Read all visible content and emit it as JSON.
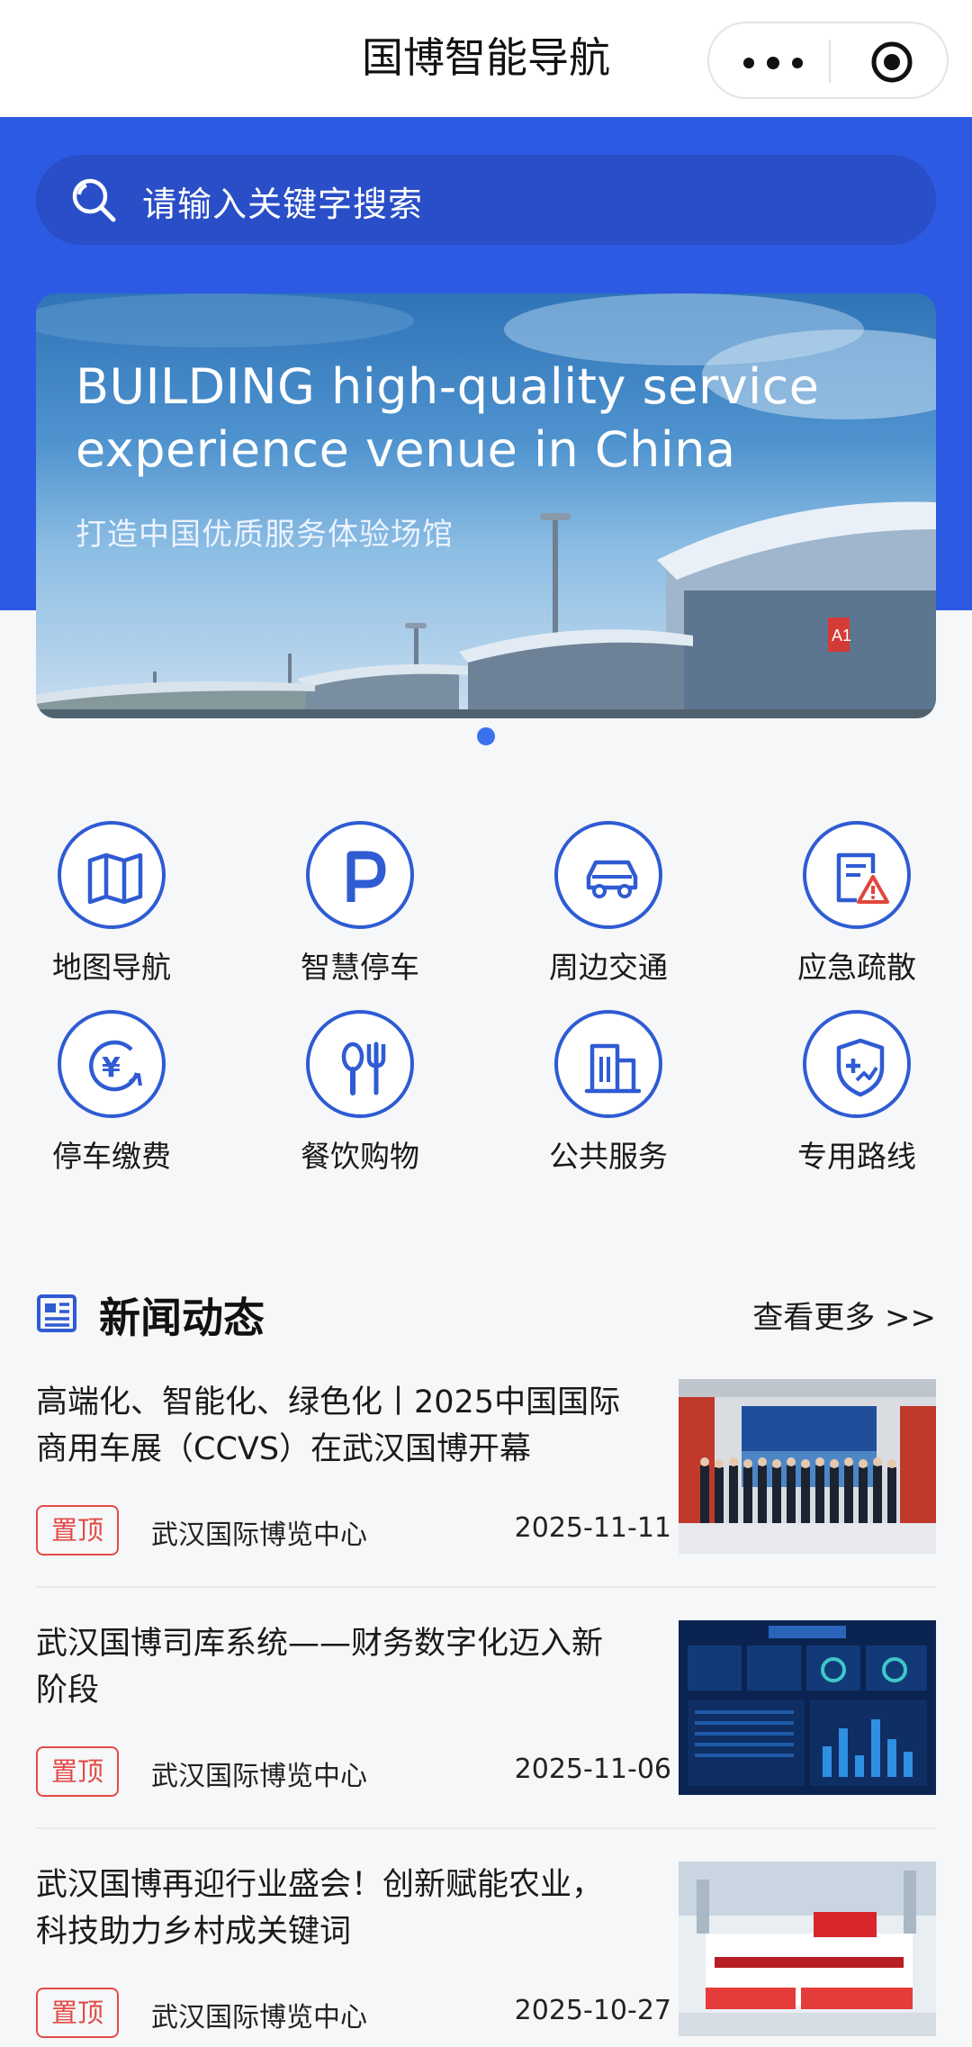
{
  "app": {
    "title": "国博智能导航"
  },
  "capsule": {
    "more_icon": "more-dots-icon",
    "close_icon": "target-icon"
  },
  "search": {
    "placeholder": "请输入关键字搜索",
    "icon": "search-icon"
  },
  "banner": {
    "line1": "BUILDING high-quality service",
    "line2": "experience venue in China",
    "subtitle": "打造中国优质服务体验场馆",
    "slide_index": 1,
    "slide_count": 1
  },
  "features": [
    {
      "label": "地图导航",
      "icon": "map-icon"
    },
    {
      "label": "智慧停车",
      "icon": "parking-icon"
    },
    {
      "label": "周边交通",
      "icon": "car-icon"
    },
    {
      "label": "应急疏散",
      "icon": "emergency-icon"
    },
    {
      "label": "停车缴费",
      "icon": "yen-payment-icon"
    },
    {
      "label": "餐饮购物",
      "icon": "dining-icon"
    },
    {
      "label": "公共服务",
      "icon": "building-icon"
    },
    {
      "label": "专用路线",
      "icon": "shield-route-icon"
    }
  ],
  "news": {
    "title": "新闻动态",
    "more": "查看更多 >>",
    "items": [
      {
        "title": "高端化、智能化、绿色化丨2025中国国际商用车展（CCVS）在武汉国博开幕",
        "tag": "置顶",
        "source": "武汉国际博览中心",
        "date": "2025-11-11"
      },
      {
        "title": "武汉国博司库系统——财务数字化迈入新阶段",
        "tag": "置顶",
        "source": "武汉国际博览中心",
        "date": "2025-11-06"
      },
      {
        "title": "武汉国博再迎行业盛会！创新赋能农业，科技助力乡村成关键词",
        "tag": "置顶",
        "source": "武汉国际博览中心",
        "date": "2025-10-27"
      }
    ]
  },
  "colors": {
    "primary": "#2d5ae3",
    "icon_blue": "#2f5bd3",
    "tag_red": "#e24b47",
    "alert_red": "#e0463c"
  }
}
